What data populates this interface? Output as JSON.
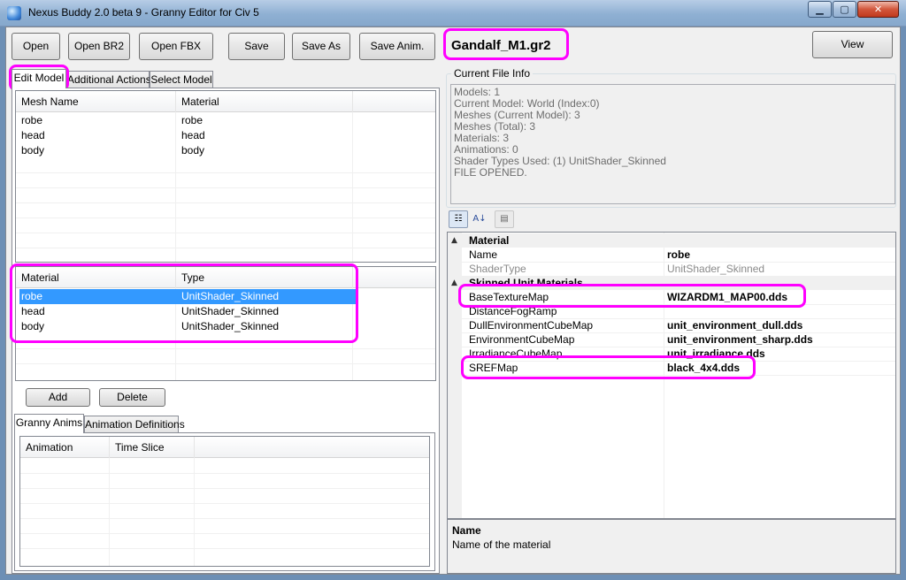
{
  "window": {
    "title": "Nexus Buddy 2.0 beta 9 - Granny Editor for Civ 5",
    "controls": {
      "minimize": "▁",
      "maximize": "▢",
      "close": "✕"
    }
  },
  "toolbar": {
    "open": "Open",
    "open_br2": "Open BR2",
    "open_fbx": "Open FBX",
    "save": "Save",
    "save_as": "Save As",
    "save_anim": "Save Anim.",
    "view": "View"
  },
  "file_name": "Gandalf_M1.gr2",
  "left_tabs": [
    "Edit Model",
    "Additional Actions",
    "Select Model"
  ],
  "mesh_list": {
    "columns": [
      "Mesh Name",
      "Material"
    ],
    "rows": [
      [
        "robe",
        "robe"
      ],
      [
        "head",
        "head"
      ],
      [
        "body",
        "body"
      ]
    ]
  },
  "material_list": {
    "columns": [
      "Material",
      "Type"
    ],
    "rows": [
      [
        "robe",
        "UnitShader_Skinned"
      ],
      [
        "head",
        "UnitShader_Skinned"
      ],
      [
        "body",
        "UnitShader_Skinned"
      ]
    ],
    "selected_index": 0
  },
  "buttons": {
    "add": "Add",
    "delete": "Delete"
  },
  "anim_tabs": [
    "Granny Anims",
    "Animation Definitions"
  ],
  "anim_list": {
    "columns": [
      "Animation",
      "Time Slice"
    ],
    "rows": []
  },
  "file_info": {
    "legend": "Current File Info",
    "lines": [
      "Models: 1",
      "Current Model: World (Index:0)",
      "Meshes (Current Model): 3",
      "Meshes (Total): 3",
      "Materials: 3",
      "Animations: 0",
      "Shader Types Used: (1) UnitShader_Skinned",
      "FILE OPENED."
    ]
  },
  "property_grid": {
    "toolbar_icons": [
      "categorized-icon",
      "alphabetical-sort-icon",
      "property-pages-icon"
    ],
    "toolbar_glyphs": [
      "☷",
      "A↓",
      "▤"
    ],
    "rows": [
      {
        "kind": "category",
        "name": "Material",
        "toggle": "▲"
      },
      {
        "kind": "prop",
        "name": "Name",
        "value": "robe",
        "dim": false
      },
      {
        "kind": "prop",
        "name": "ShaderType",
        "value": "UnitShader_Skinned",
        "dim": true
      },
      {
        "kind": "category",
        "name": "Skinned Unit Materials",
        "toggle": "▲"
      },
      {
        "kind": "prop",
        "name": "BaseTextureMap",
        "value": "WIZARDM1_MAP00.dds",
        "dim": false
      },
      {
        "kind": "prop",
        "name": "DistanceFogRamp",
        "value": "",
        "dim": false
      },
      {
        "kind": "prop",
        "name": "DullEnvironmentCubeMap",
        "value": "unit_environment_dull.dds",
        "dim": false
      },
      {
        "kind": "prop",
        "name": "EnvironmentCubeMap",
        "value": "unit_environment_sharp.dds",
        "dim": false
      },
      {
        "kind": "prop",
        "name": "IrradianceCubeMap",
        "value": "unit_irradiance.dds",
        "dim": false
      },
      {
        "kind": "prop",
        "name": "SREFMap",
        "value": "black_4x4.dds",
        "dim": false
      }
    ]
  },
  "help": {
    "title": "Name",
    "description": "Name of the material"
  },
  "colors": {
    "highlight": "#ff00ff",
    "selection": "#3399ff"
  }
}
